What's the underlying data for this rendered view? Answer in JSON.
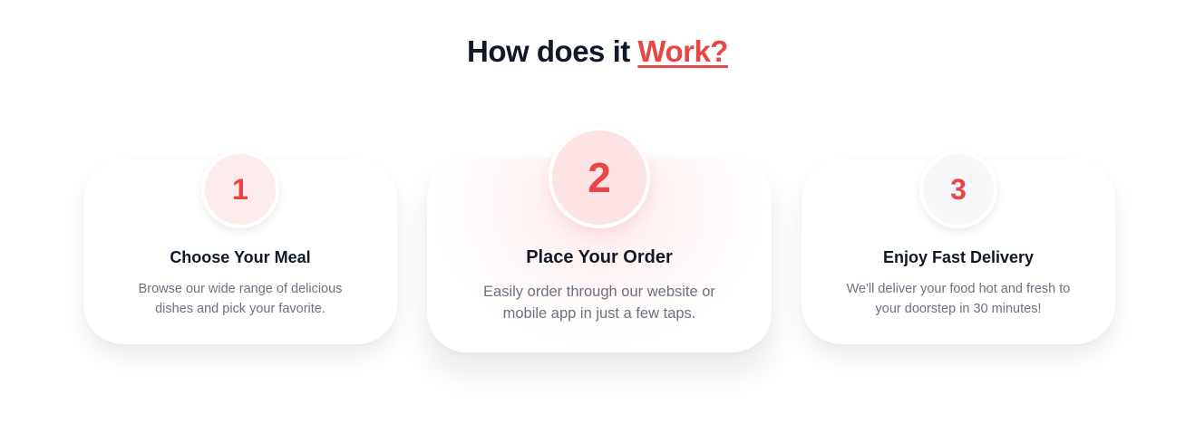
{
  "heading": {
    "prefix": "How does it ",
    "accent": "Work?"
  },
  "steps": [
    {
      "number": "1",
      "title": "Choose Your Meal",
      "description": "Browse our wide range of delicious dishes and pick your favorite."
    },
    {
      "number": "2",
      "title": "Place Your Order",
      "description": "Easily order through our website or mobile app in just a few taps."
    },
    {
      "number": "3",
      "title": "Enjoy Fast Delivery",
      "description": "We'll deliver your food hot and fresh to your doorstep in 30 minutes!"
    }
  ],
  "colors": {
    "accent": "#e84545",
    "heading": "#111827",
    "body_text": "#6b7280"
  }
}
